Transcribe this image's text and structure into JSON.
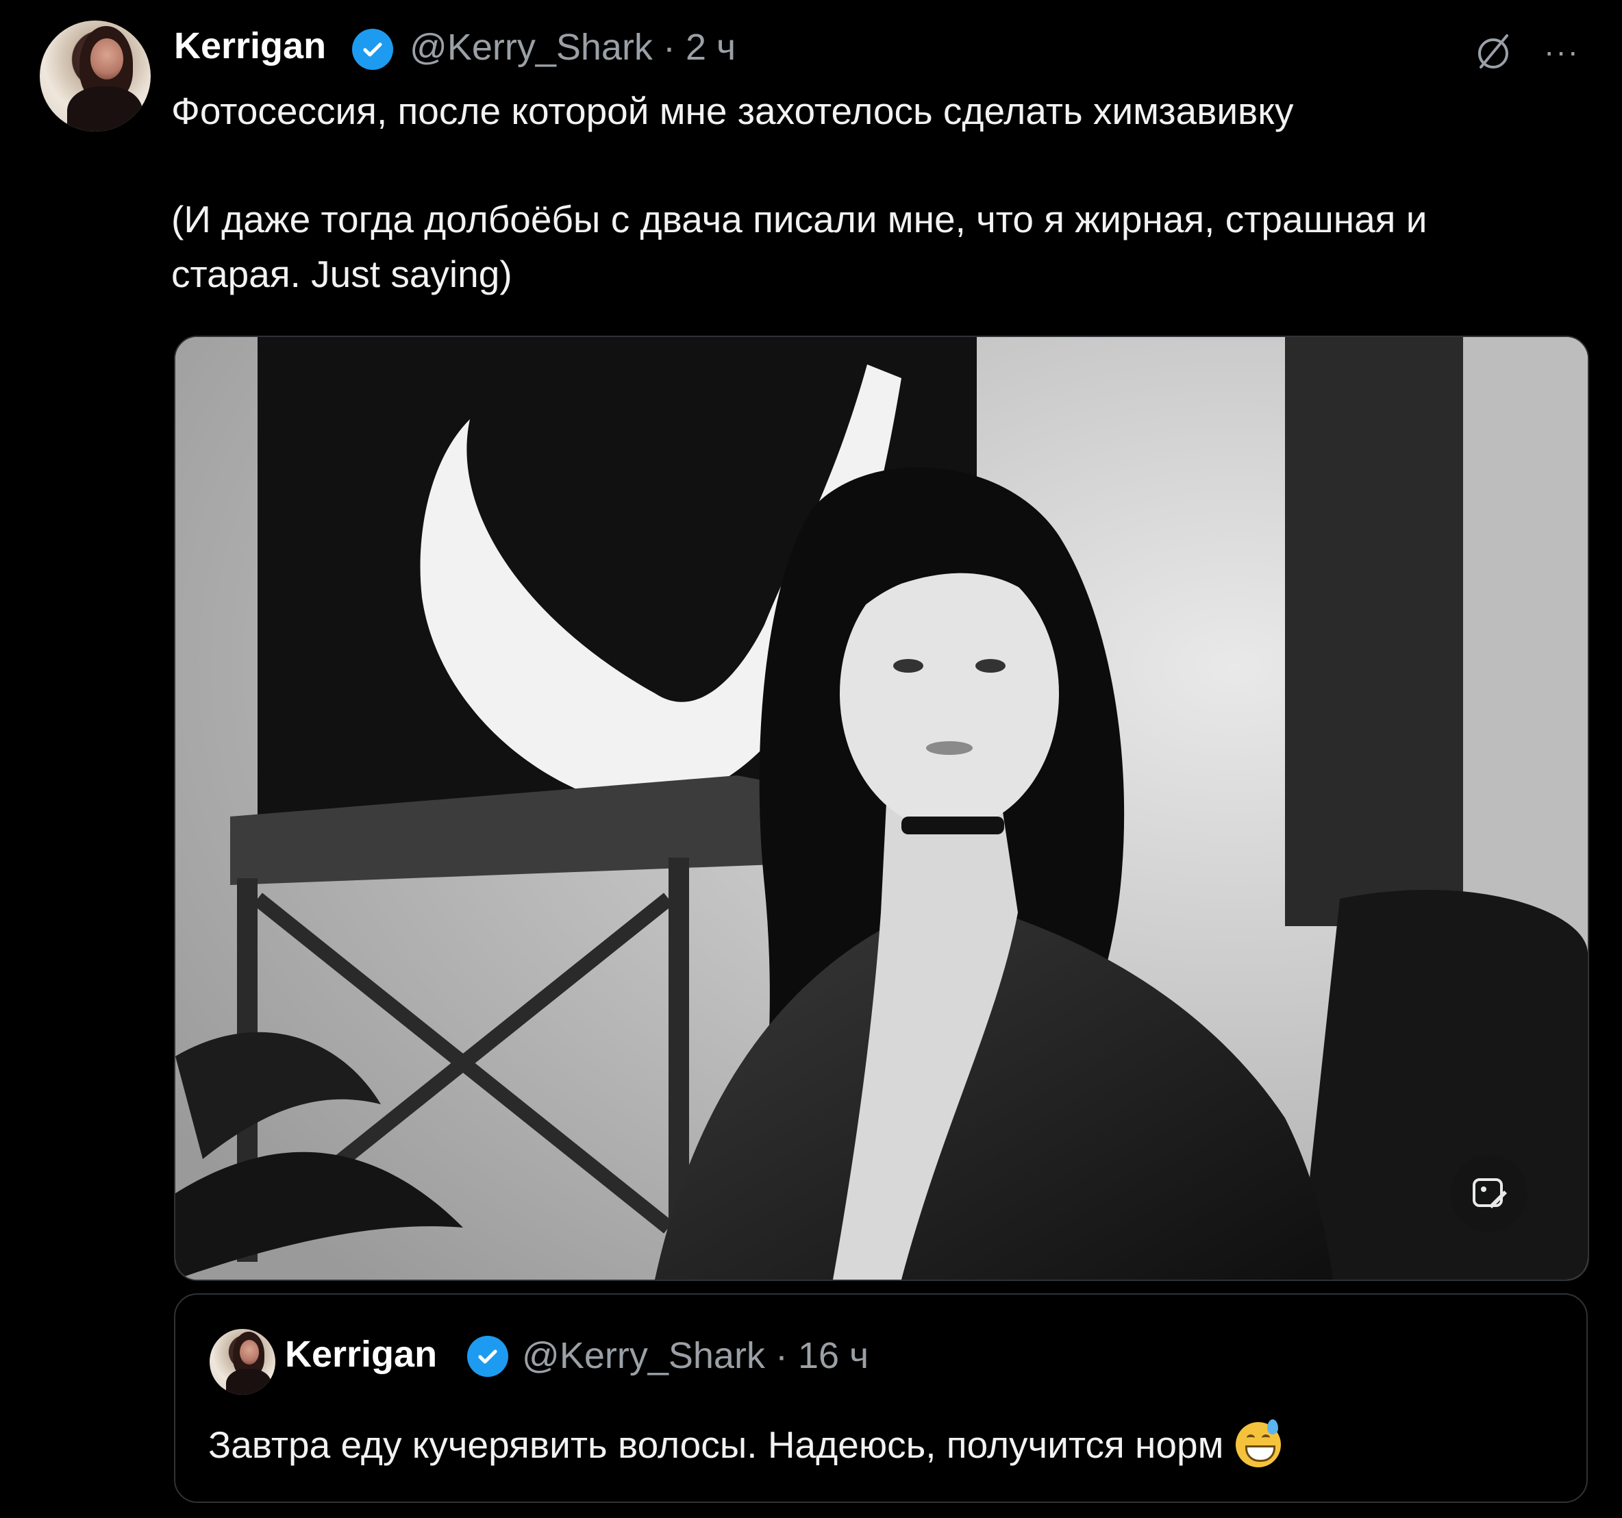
{
  "tweet": {
    "author_name": "Kerrigan",
    "handle": "@Kerry_Shark",
    "separator": "·",
    "time": "2 ч",
    "text_line1": "Фотосессия, после которой мне захотелось сделать химзавивку",
    "text_line2": "(И даже тогда долбоёбы с двача писали мне, что я жирная, страшная и",
    "text_line3": "старая. Just saying)",
    "more_label": "···",
    "verified_color": "#1d9bf0"
  },
  "quote": {
    "author_name": "Kerrigan",
    "handle": "@Kerry_Shark",
    "separator": "·",
    "time": "16 ч",
    "text": "Завтра еду кучерявить волосы. Надеюсь, получится норм"
  },
  "icons": {
    "grok": "slash-circle-icon",
    "more": "more-dots-icon",
    "verified": "verified-badge-icon",
    "media_action": "image-edit-icon",
    "emoji": "grinning-sweat-emoji-icon"
  }
}
